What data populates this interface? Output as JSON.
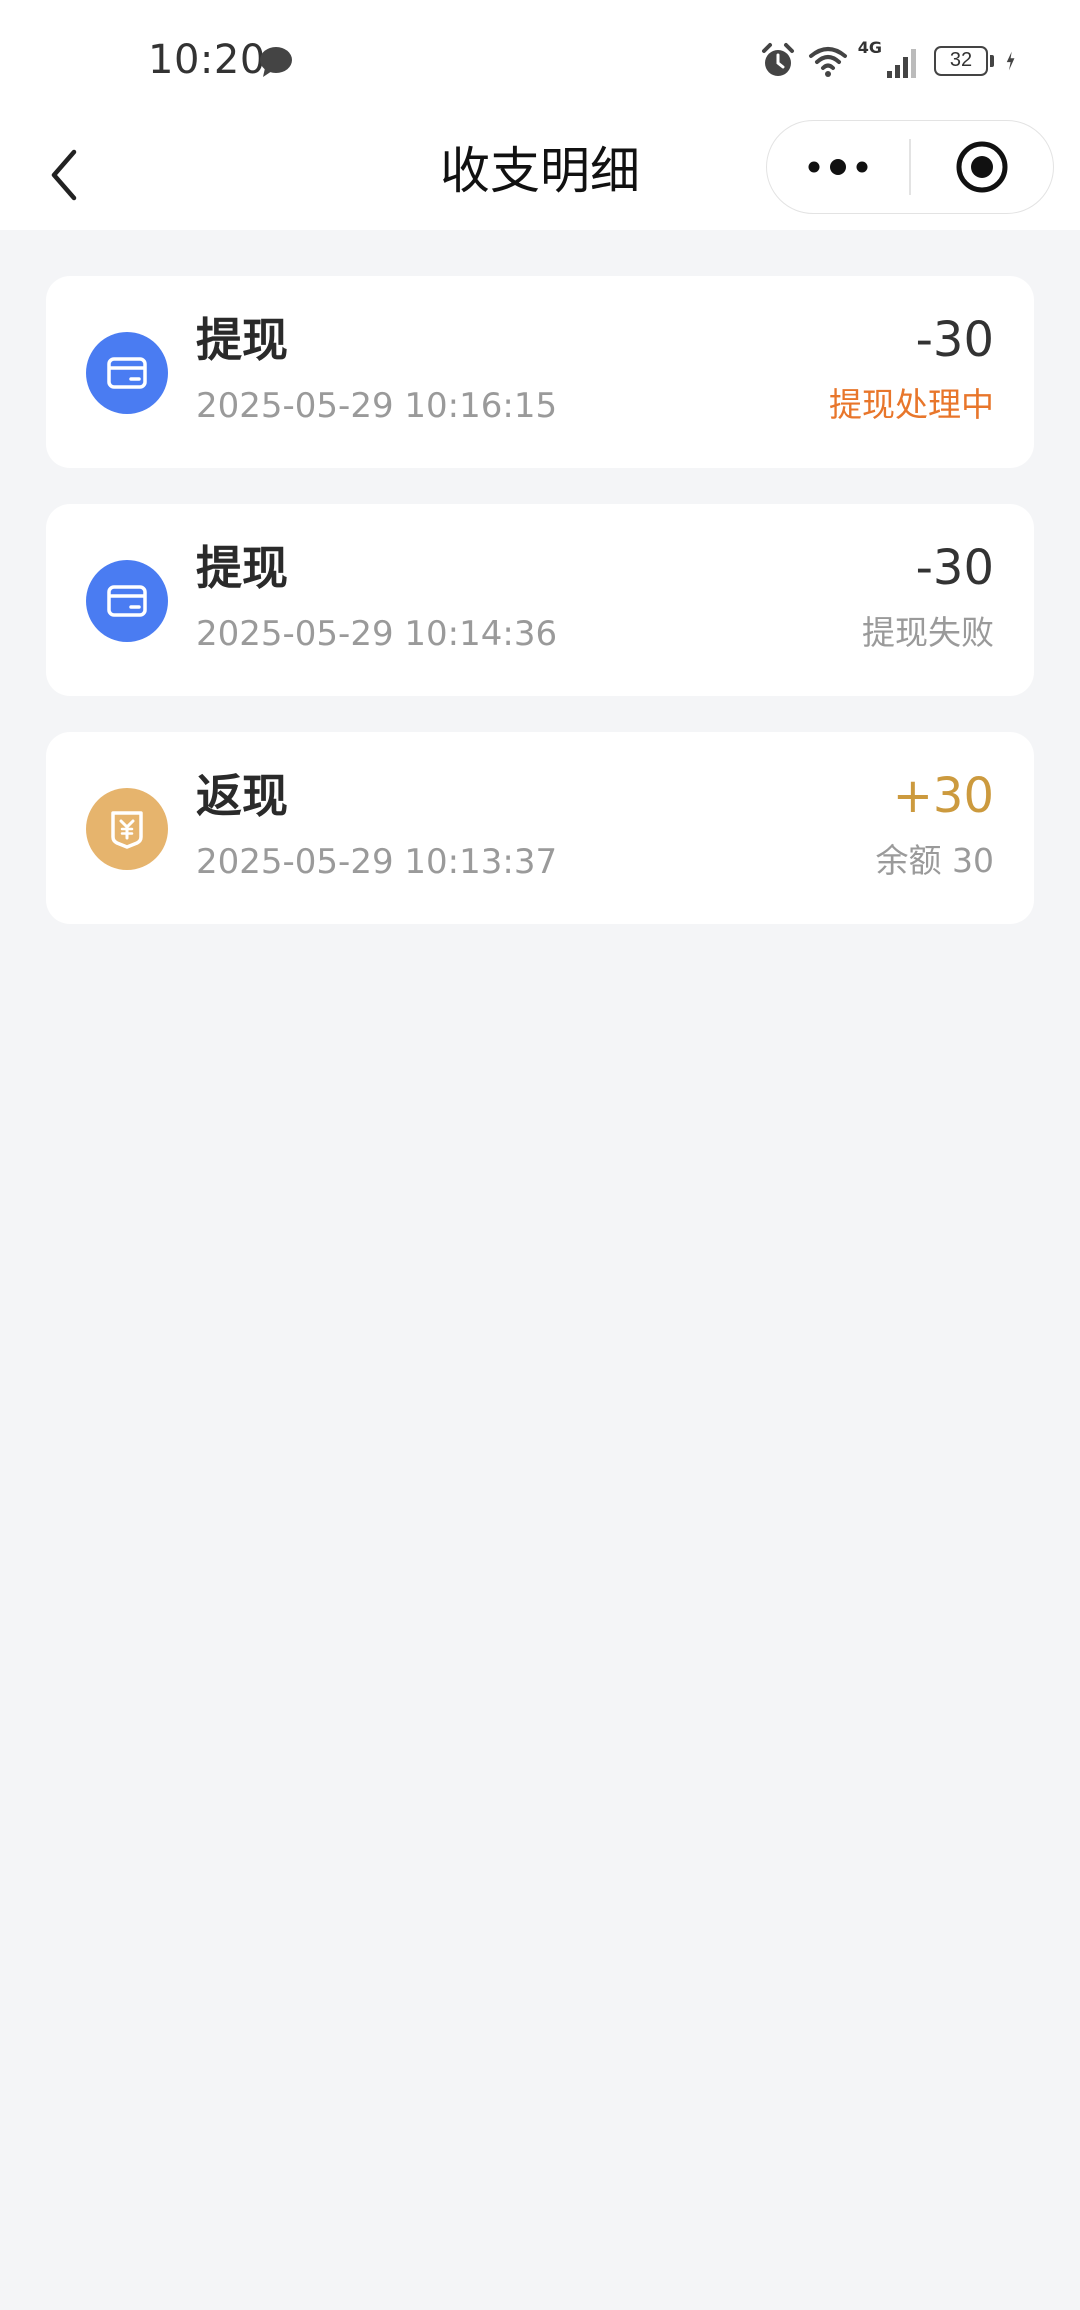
{
  "status_bar": {
    "time": "10:20",
    "network_label": "4G",
    "battery_level": "32"
  },
  "nav": {
    "title": "收支明细"
  },
  "colors": {
    "withdraw_icon_bg": "#4a7cf2",
    "cashback_icon_bg": "#e6b46d",
    "status_processing": "#e8762b",
    "amount_positive": "#cc9a3e",
    "amount_negative": "#333333",
    "muted_text": "#9a9a9a"
  },
  "records": [
    {
      "icon": "card-icon",
      "title": "提现",
      "time": "2025-05-29 10:16:15",
      "amount": "-30",
      "status": "提现处理中"
    },
    {
      "icon": "card-icon",
      "title": "提现",
      "time": "2025-05-29 10:14:36",
      "amount": "-30",
      "status": "提现失败"
    },
    {
      "icon": "yuan-pocket-icon",
      "title": "返现",
      "time": "2025-05-29 10:13:37",
      "amount": "+30",
      "status": "余额 30"
    }
  ]
}
